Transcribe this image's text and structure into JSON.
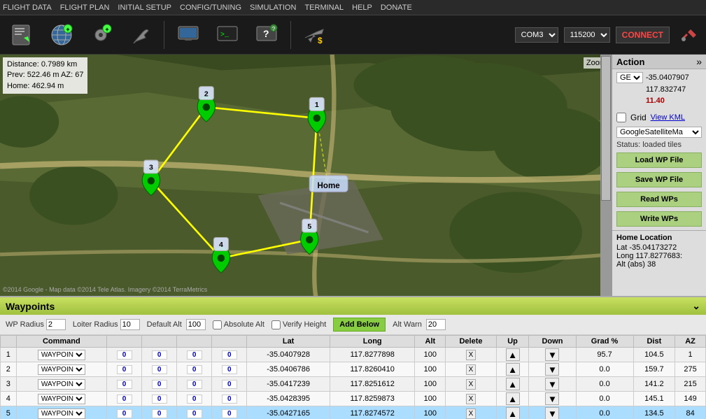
{
  "menuBar": {
    "items": [
      "FLIGHT DATA",
      "FLIGHT PLAN",
      "INITIAL SETUP",
      "CONFIG/TUNING",
      "SIMULATION",
      "TERMINAL",
      "HELP",
      "DONATE"
    ]
  },
  "toolbar": {
    "buttons": [
      {
        "name": "flight-data-btn",
        "icon": "📋"
      },
      {
        "name": "flight-plan-btn",
        "icon": "🌐"
      },
      {
        "name": "initial-setup-btn",
        "icon": "⚙"
      },
      {
        "name": "config-tuning-btn",
        "icon": "🔧"
      },
      {
        "name": "simulation-btn",
        "icon": "🖥"
      },
      {
        "name": "terminal-btn",
        "icon": "📟"
      },
      {
        "name": "help-btn",
        "icon": "💻"
      },
      {
        "name": "donate-btn",
        "icon": "✈"
      }
    ],
    "comPort": "COM3",
    "baudRate": "115200",
    "connectLabel": "CONNECT"
  },
  "mapInfo": {
    "distance": "Distance: 0.7989 km",
    "prev": "Prev: 522.46 m AZ: 67",
    "home": "Home: 462.94 m"
  },
  "mapZoom": "Zoom",
  "mapCopyright": "©2014 Google - Map data ©2014 Tele Atlas. Imagery ©2014 TerraMetrics",
  "actionPanel": {
    "title": "Action",
    "geoType": "GEO",
    "lat": "-35.0407907",
    "lon": "117.832747",
    "alt": "11.40",
    "gridLabel": "Grid",
    "viewKml": "View KML",
    "mapTypeOptions": [
      "GoogleSatelliteMa"
    ],
    "selectedMapType": "GoogleSatelliteMa",
    "status": "Status: loaded tiles",
    "loadWpFile": "Load WP File",
    "saveWpFile": "Save WP File",
    "readWPs": "Read WPs",
    "writeWPs": "Write WPs",
    "homeLocation": "Home Location",
    "homeLat": "Lat   -35.04173272",
    "homeLon": "Long  117.8277683:",
    "homeAlt": "Alt (abs) 38"
  },
  "waypointsPanel": {
    "title": "Waypoints",
    "controls": {
      "wpRadius": {
        "label": "WP Radius",
        "value": "2"
      },
      "loiterRadius": {
        "label": "Loiter Radius",
        "value": "10"
      },
      "defaultAlt": {
        "label": "Default Alt",
        "value": "100"
      },
      "absoluteAlt": {
        "label": "Absolute Alt",
        "checked": false
      },
      "verifyHeight": {
        "label": "Verify Height",
        "checked": false
      },
      "addBelow": "Add Below",
      "altWarn": {
        "label": "Alt Warn",
        "value": "20"
      }
    },
    "columns": [
      "",
      "Command",
      "",
      "",
      "",
      "",
      "Lat",
      "Long",
      "Alt",
      "Delete",
      "Up",
      "Down",
      "Grad %",
      "Dist",
      "AZ"
    ],
    "rows": [
      {
        "num": 1,
        "command": "WAYPOINT",
        "p1": "0",
        "p2": "0",
        "p3": "0",
        "p4": "0",
        "lat": "-35.0407928",
        "lon": "117.8277898",
        "alt": "100",
        "delete": "X",
        "grad": "95.7",
        "dist": "104.5",
        "az": "1",
        "selected": false
      },
      {
        "num": 2,
        "command": "WAYPOINT",
        "p1": "0",
        "p2": "0",
        "p3": "0",
        "p4": "0",
        "lat": "-35.0406786",
        "lon": "117.8260410",
        "alt": "100",
        "delete": "X",
        "grad": "0.0",
        "dist": "159.7",
        "az": "275",
        "selected": false
      },
      {
        "num": 3,
        "command": "WAYPOINT",
        "p1": "0",
        "p2": "0",
        "p3": "0",
        "p4": "0",
        "lat": "-35.0417239",
        "lon": "117.8251612",
        "alt": "100",
        "delete": "X",
        "grad": "0.0",
        "dist": "141.2",
        "az": "215",
        "selected": false
      },
      {
        "num": 4,
        "command": "WAYPOINT",
        "p1": "0",
        "p2": "0",
        "p3": "0",
        "p4": "0",
        "lat": "-35.0428395",
        "lon": "117.8259873",
        "alt": "100",
        "delete": "X",
        "grad": "0.0",
        "dist": "145.1",
        "az": "149",
        "selected": false
      },
      {
        "num": 5,
        "command": "WAYPOINT",
        "p1": "0",
        "p2": "0",
        "p3": "0",
        "p4": "0",
        "lat": "-35.0427165",
        "lon": "117.8274572",
        "alt": "100",
        "delete": "X",
        "grad": "0.0",
        "dist": "134.5",
        "az": "84",
        "selected": true
      }
    ]
  }
}
